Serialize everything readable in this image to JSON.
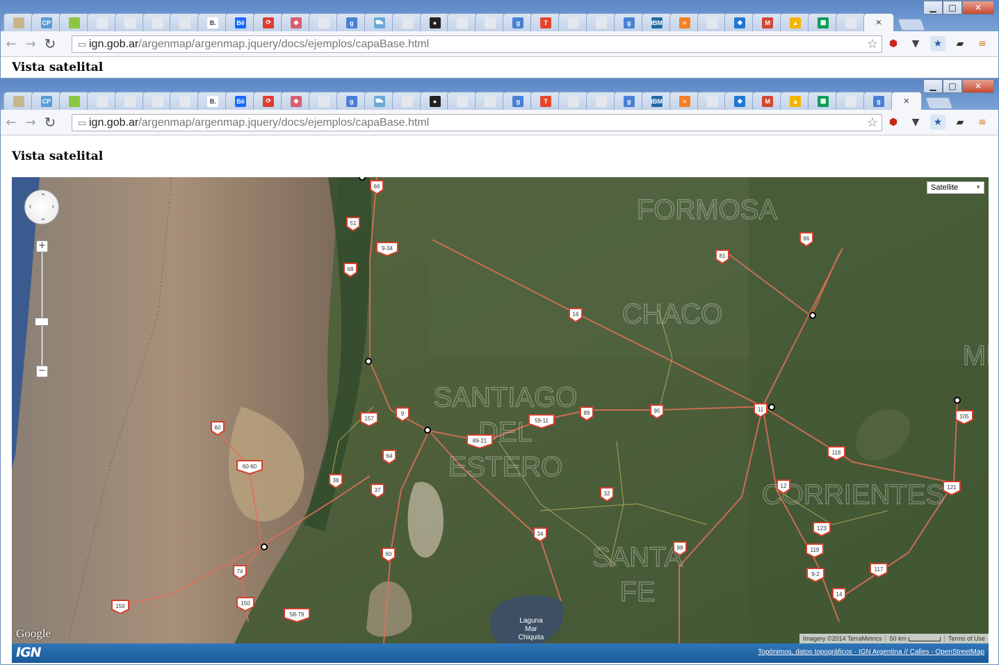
{
  "browser": {
    "close_tab_glyph": "×",
    "window_buttons": {
      "minimize": "▁",
      "maximize": "□",
      "close": "✕"
    },
    "url_host": "ign.gob.ar",
    "url_path": "/argenmap/argenmap.jquery/docs/ejemplos/capaBase.html",
    "tabs": [
      {
        "icon": "notebook-icon",
        "glyph": "",
        "color": "#c8b58a"
      },
      {
        "icon": "cp-icon",
        "glyph": "CP",
        "color": "#5a9bd5"
      },
      {
        "icon": "green-square-icon",
        "glyph": "",
        "color": "#8dc63f"
      },
      {
        "icon": "page-icon",
        "glyph": "",
        "color": "#e4e8ee"
      },
      {
        "icon": "page-icon",
        "glyph": "",
        "color": "#e4e8ee"
      },
      {
        "icon": "page-icon",
        "glyph": "",
        "color": "#e4e8ee"
      },
      {
        "icon": "page-icon",
        "glyph": "",
        "color": "#e4e8ee"
      },
      {
        "icon": "b-icon",
        "glyph": "B.",
        "color": "#ffffff"
      },
      {
        "icon": "behance-icon",
        "glyph": "Bē",
        "color": "#1769ff"
      },
      {
        "icon": "sync-icon",
        "glyph": "⟳",
        "color": "#e03c31"
      },
      {
        "icon": "cube-icon",
        "glyph": "◆",
        "color": "#d6606f"
      },
      {
        "icon": "page-icon",
        "glyph": "",
        "color": "#e4e8ee"
      },
      {
        "icon": "google-icon",
        "glyph": "g",
        "color": "#4a7fd6"
      },
      {
        "icon": "car-icon",
        "glyph": "⛟",
        "color": "#6aa8d8"
      },
      {
        "icon": "page-icon",
        "glyph": "",
        "color": "#e4e8ee"
      },
      {
        "icon": "github-icon",
        "glyph": "●",
        "color": "#222222"
      },
      {
        "icon": "page-icon",
        "glyph": "",
        "color": "#e4e8ee"
      },
      {
        "icon": "page-icon",
        "glyph": "",
        "color": "#e4e8ee"
      },
      {
        "icon": "google-icon",
        "glyph": "g",
        "color": "#4a7fd6"
      },
      {
        "icon": "t-icon",
        "glyph": "T",
        "color": "#e6442c"
      },
      {
        "icon": "page-icon",
        "glyph": "",
        "color": "#e4e8ee"
      },
      {
        "icon": "page-icon",
        "glyph": "",
        "color": "#e4e8ee"
      },
      {
        "icon": "google-icon",
        "glyph": "g",
        "color": "#4a7fd6"
      },
      {
        "icon": "ibm-icon",
        "glyph": "IBM",
        "color": "#1f6aa5"
      },
      {
        "icon": "stackoverflow-icon",
        "glyph": "≡",
        "color": "#f48024"
      },
      {
        "icon": "page-icon",
        "glyph": "",
        "color": "#e4e8ee"
      },
      {
        "icon": "diamond-icon",
        "glyph": "◆",
        "color": "#1f78d1"
      },
      {
        "icon": "gmail-icon",
        "glyph": "M",
        "color": "#d14836"
      },
      {
        "icon": "drive-icon",
        "glyph": "▲",
        "color": "#f4b400"
      },
      {
        "icon": "sheets-icon",
        "glyph": "▦",
        "color": "#0f9d58"
      },
      {
        "icon": "page-icon",
        "glyph": "",
        "color": "#e4e8ee"
      }
    ],
    "front_extra_tab": {
      "icon": "google-icon",
      "glyph": "g",
      "color": "#4a7fd6"
    }
  },
  "page": {
    "heading": "Vista satelital"
  },
  "map": {
    "type_selector": "Satellite",
    "zoom_in": "+",
    "zoom_out": "−",
    "google_logo": "Google",
    "imagery_credit": "Imagery ©2014 TerraMetrics",
    "scale_label": "50 km",
    "terms": "Terms of Use",
    "region_labels": [
      "FORMOSA",
      "CHACO",
      "SANTIAGO DEL ESTERO",
      "CORRIENTES",
      "SANTA FE",
      "MI"
    ],
    "lake_label": "Laguna\nMar\nChiquita",
    "route_shields": [
      "66",
      "51",
      "9-34",
      "68",
      "16",
      "81",
      "86",
      "157",
      "9",
      "64",
      "38",
      "37",
      "60",
      "60-60",
      "89",
      "95",
      "59-11",
      "89-21",
      "32",
      "34",
      "98",
      "11",
      "105",
      "118",
      "12",
      "121",
      "123",
      "119",
      "9-2",
      "117",
      "14",
      "74",
      "150",
      "150",
      "60",
      "58-79"
    ]
  },
  "footer": {
    "logo": "IGN",
    "link": "Topónimos, datos topográficos - IGN Argentina // Calles - OpenStreetMap"
  }
}
